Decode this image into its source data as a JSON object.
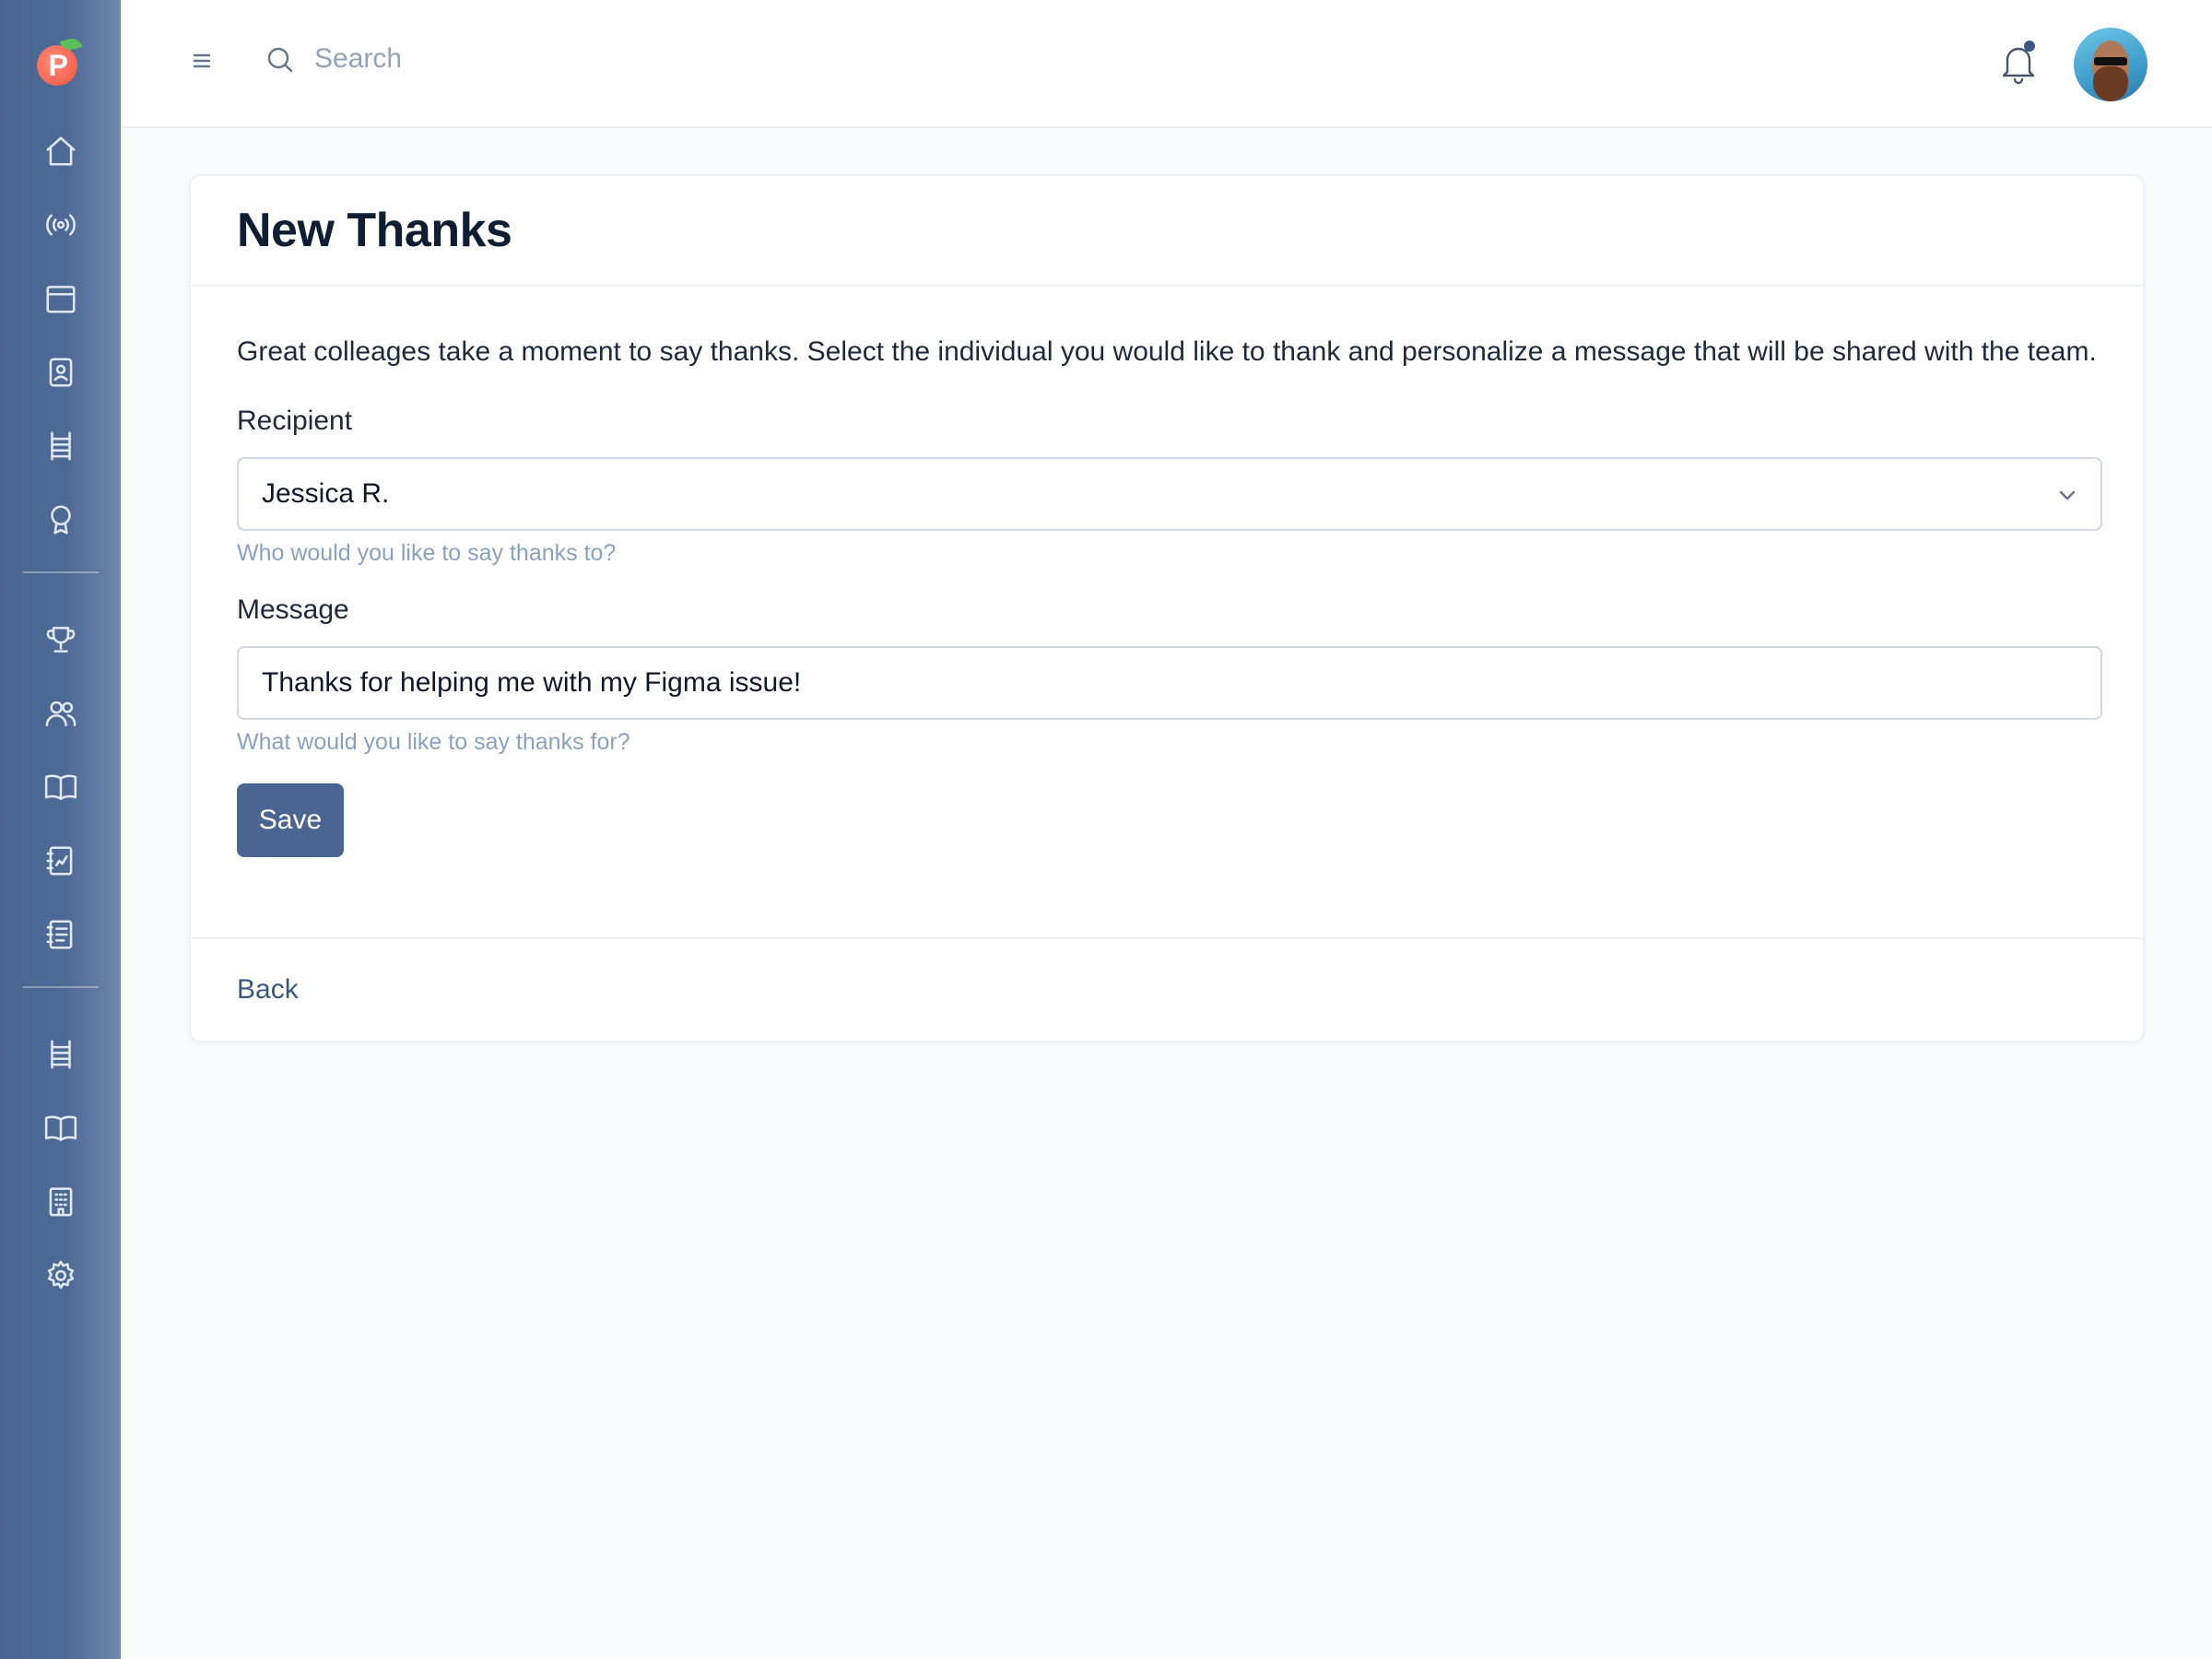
{
  "header": {
    "search_placeholder": "Search",
    "icons": [
      "menu-icon",
      "search-icon",
      "bell-icon",
      "avatar"
    ]
  },
  "sidebar": {
    "groups": [
      [
        "home-icon",
        "broadcast-icon",
        "calendar-icon",
        "badge-icon",
        "ladder-icon",
        "award-icon"
      ],
      [
        "trophy-icon",
        "users-icon",
        "book-icon",
        "report-icon",
        "document-icon"
      ],
      [
        "ladder-icon",
        "book-icon",
        "building-icon",
        "gear-icon"
      ]
    ]
  },
  "page": {
    "title": "New Thanks",
    "intro": "Great colleages take a moment to say thanks. Select the individual you would like to thank and personalize a message that will be shared with the team.",
    "recipient": {
      "label": "Recipient",
      "value": "Jessica R.",
      "hint": "Who would you like to say thanks to?"
    },
    "message": {
      "label": "Message",
      "value": "Thanks for helping me with my Figma issue!",
      "hint": "What would you like to say thanks for?"
    },
    "save_label": "Save",
    "back_label": "Back"
  },
  "colors": {
    "sidebar": "#4a6591",
    "primary_button": "#4a6591",
    "link": "#3b5680",
    "hint": "#8aa1bf"
  }
}
